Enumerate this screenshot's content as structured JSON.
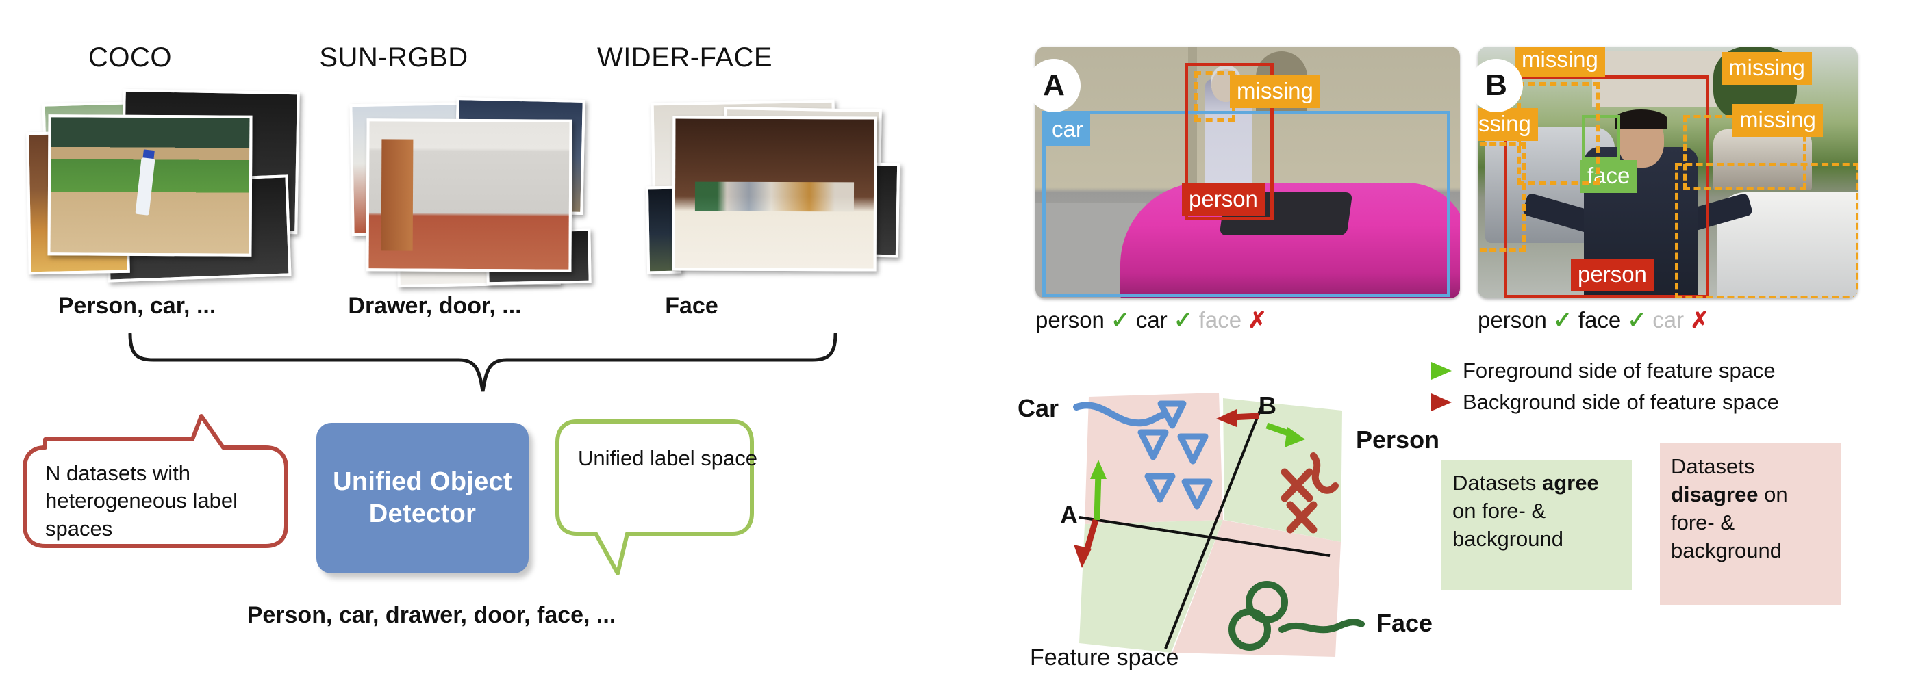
{
  "left_panel": {
    "datasets": [
      {
        "title": "COCO",
        "labels": "Person, car, ..."
      },
      {
        "title": "SUN-RGBD",
        "labels": "Drawer, door, ..."
      },
      {
        "title": "WIDER-FACE",
        "labels": "Face"
      }
    ],
    "left_callout": {
      "text": "N datasets with heterogeneous label spaces",
      "color": "#b5483f"
    },
    "detector": {
      "line1": "Unified Object",
      "line2": "Detector",
      "color": "#6a8dc4"
    },
    "right_callout": {
      "text": "Unified label space",
      "color": "#9ec45a"
    },
    "unified_labels": "Person, car, drawer, door, face, ..."
  },
  "right_panel": {
    "images": [
      {
        "letter": "A",
        "boxes": [
          {
            "label": "car",
            "color": "#5fa8dd"
          },
          {
            "label": "person",
            "color": "#cc2b17"
          },
          {
            "label": "missing",
            "color": "#f0a31c"
          }
        ],
        "caption": {
          "items": [
            {
              "text": "person",
              "mark": "check",
              "muted": false
            },
            {
              "text": "car",
              "mark": "check",
              "muted": false
            },
            {
              "text": "face",
              "mark": "cross",
              "muted": true
            }
          ]
        }
      },
      {
        "letter": "B",
        "boxes": [
          {
            "label": "face",
            "color": "#78bd4f"
          },
          {
            "label": "person",
            "color": "#cc2b17"
          },
          {
            "label": "missing",
            "color": "#f0a31c"
          },
          {
            "label": "missing",
            "color": "#f0a31c"
          },
          {
            "label": "missing",
            "color": "#f0a31c"
          },
          {
            "label": "missing",
            "color": "#f0a31c"
          }
        ],
        "caption": {
          "items": [
            {
              "text": "person",
              "mark": "check",
              "muted": false
            },
            {
              "text": "face",
              "mark": "check",
              "muted": false
            },
            {
              "text": "car",
              "mark": "cross",
              "muted": true
            }
          ]
        }
      }
    ],
    "legend": [
      {
        "arrow": "green-arrow-icon",
        "color": "#62c31f",
        "text": "Foreground side of feature space"
      },
      {
        "arrow": "red-arrow-icon",
        "color": "#b5281e",
        "text": "Background side of feature space"
      }
    ],
    "feature_space": {
      "caption": "Feature space",
      "cluster_labels": {
        "car": "Car",
        "person": "Person",
        "face": "Face"
      },
      "markers": {
        "A": "A",
        "B": "B"
      },
      "quadrant_colors": {
        "foreground": "#dceacd",
        "background": "#f2d9d4"
      }
    },
    "notes": [
      {
        "prefix": "Datasets ",
        "bold": "agree",
        "suffix": " on fore- & background",
        "bg": "#dceacd"
      },
      {
        "prefix": "Datasets ",
        "bold": "disagree",
        "suffix": " on fore- & background",
        "bg": "#f2d9d4"
      }
    ]
  }
}
